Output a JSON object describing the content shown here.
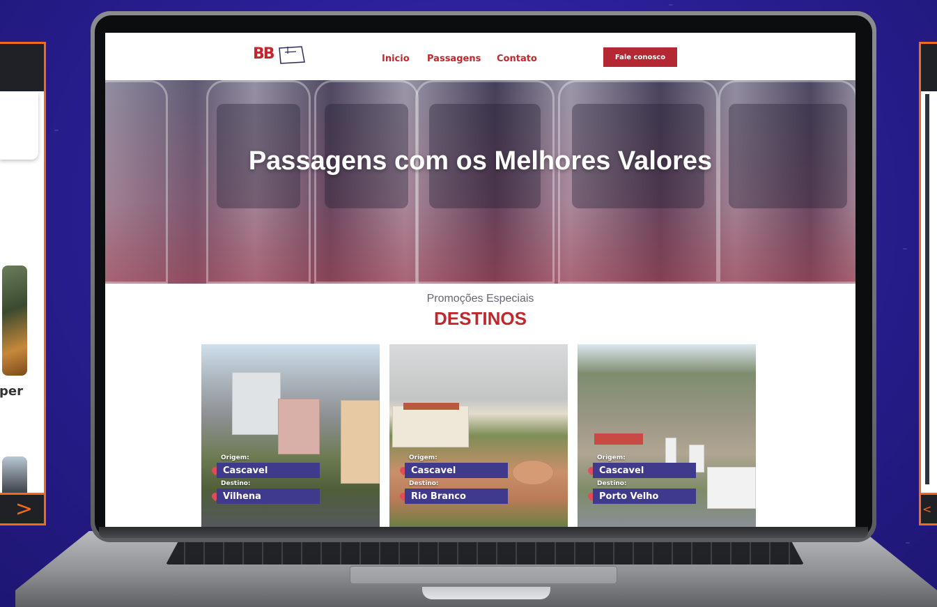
{
  "side_left": {
    "word": "per",
    "next_arrow": ">"
  },
  "side_right": {
    "prev_arrow": "<"
  },
  "site": {
    "logo_text": "BB",
    "nav": [
      {
        "label": "Inicio"
      },
      {
        "label": "Passagens"
      },
      {
        "label": "Contato"
      }
    ],
    "cta_label": "Fale conosco",
    "hero_title": "Passagens com os Melhores Valores",
    "promo_subtitle": "Promoções Especiais",
    "promo_title": "DESTINOS",
    "cards": [
      {
        "origin_label": "Origem:",
        "origin": "Cascavel",
        "dest_label": "Destino:",
        "dest": "Vilhena"
      },
      {
        "origin_label": "Origem:",
        "origin": "Cascavel",
        "dest_label": "Destino:",
        "dest": "Rio Branco"
      },
      {
        "origin_label": "Origem:",
        "origin": "Cascavel",
        "dest_label": "Destino:",
        "dest": "Porto Velho"
      }
    ]
  },
  "colors": {
    "brand_red": "#c1272d",
    "tag_purple": "#3f3a8c",
    "accent_orange": "#f26a1b",
    "background_purple": "#2a1f96"
  }
}
